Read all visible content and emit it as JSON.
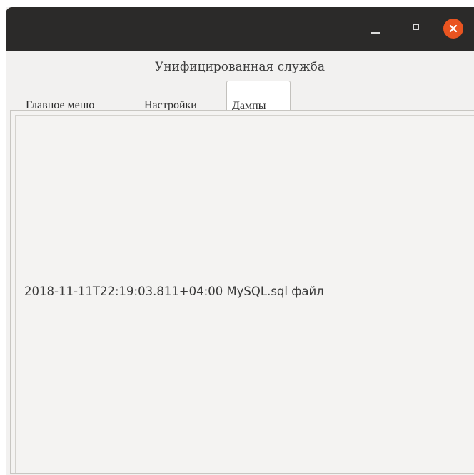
{
  "window": {
    "controls": {
      "minimize": "minimize-icon",
      "maximize": "maximize-icon",
      "close": "close-icon"
    },
    "accent_color": "#e95420"
  },
  "app": {
    "title": "Унифицированная служба"
  },
  "tabs": [
    {
      "label": "Главное меню",
      "selected": false
    },
    {
      "label": "Настройки",
      "selected": false
    },
    {
      "label": "Дампы",
      "selected": true
    }
  ],
  "dumps": {
    "items": [
      {
        "label": "2018-11-11T22:19:03.811+04:00 MySQL.sql файл"
      }
    ]
  }
}
